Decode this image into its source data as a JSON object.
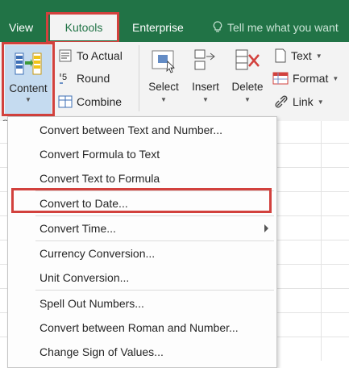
{
  "tabs": {
    "view": "View",
    "kutools": "Kutools",
    "enterprise": "Enterprise",
    "tell_me": "Tell me what you want"
  },
  "ribbon": {
    "content_label": "Content",
    "to_actual": "To Actual",
    "round": "Round",
    "combine": "Combine",
    "select": "Select",
    "insert": "Insert",
    "delete": "Delete",
    "text": "Text",
    "format": "Format",
    "link": "Link",
    "group_left_fragment": "C",
    "group_right_fragment": "g"
  },
  "menu": {
    "items": [
      "Convert between Text and Number...",
      "Convert Formula to Text",
      "Convert Text to Formula",
      "Convert to Date...",
      "Convert Time...",
      "Currency Conversion...",
      "Unit Conversion...",
      "Spell Out Numbers...",
      "Convert between Roman and Number...",
      "Change Sign of Values..."
    ],
    "highlighted_index": 3
  },
  "colors": {
    "tab_bar": "#217346",
    "ribbon": "#f3f3f3",
    "highlight_outline": "#d2413d",
    "active_button": "#c5dbf0"
  }
}
